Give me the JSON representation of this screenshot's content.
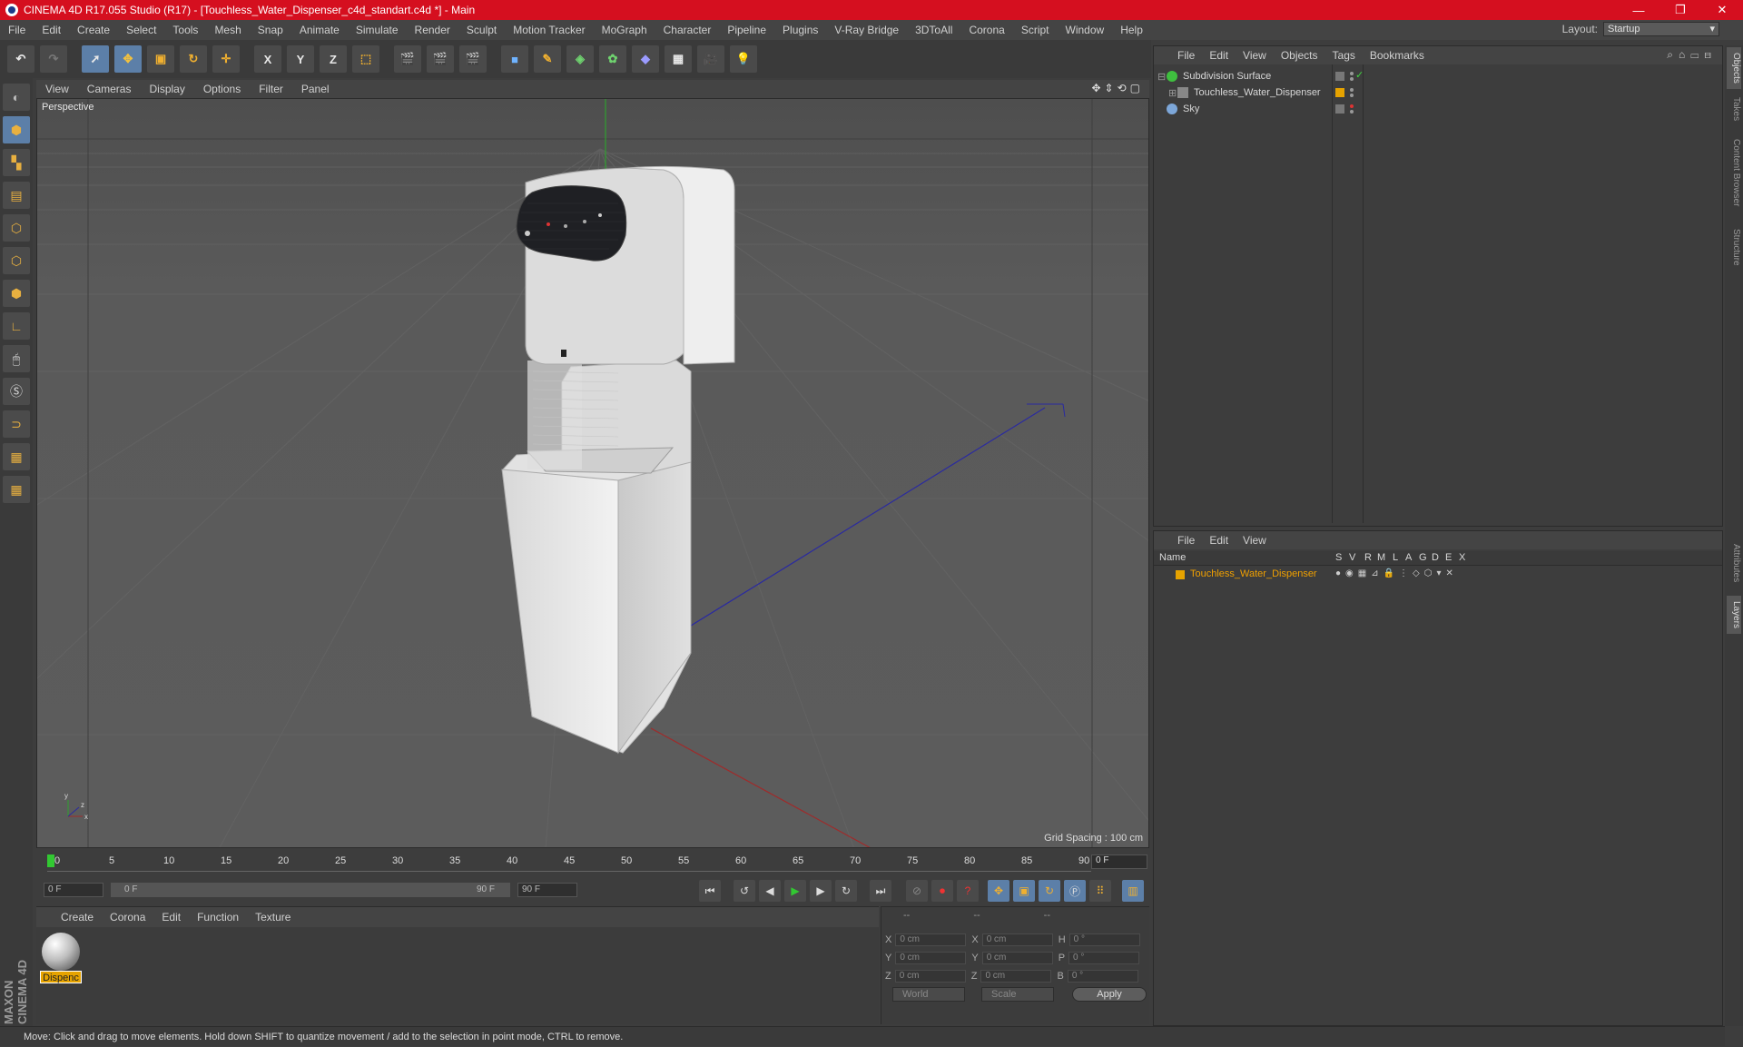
{
  "window": {
    "title": "CINEMA 4D R17.055 Studio (R17) - [Touchless_Water_Dispenser_c4d_standart.c4d *] - Main",
    "buttons": [
      "—",
      "❐",
      "✕"
    ]
  },
  "menu": [
    "File",
    "Edit",
    "Create",
    "Select",
    "Tools",
    "Mesh",
    "Snap",
    "Animate",
    "Simulate",
    "Render",
    "Sculpt",
    "Motion Tracker",
    "MoGraph",
    "Character",
    "Pipeline",
    "Plugins",
    "V-Ray Bridge",
    "3DToAll",
    "Corona",
    "Script",
    "Window",
    "Help"
  ],
  "layout": {
    "label": "Layout:",
    "value": "Startup"
  },
  "toolbar": {
    "axis_x": "X",
    "axis_y": "Y",
    "axis_z": "Z"
  },
  "viewport": {
    "menu": [
      "View",
      "Cameras",
      "Display",
      "Options",
      "Filter",
      "Panel"
    ],
    "label": "Perspective",
    "grid_spacing": "Grid Spacing : 100 cm"
  },
  "timeline": {
    "ticks": [
      "0",
      "5",
      "10",
      "15",
      "20",
      "25",
      "30",
      "35",
      "40",
      "45",
      "50",
      "55",
      "60",
      "65",
      "70",
      "75",
      "80",
      "85",
      "90"
    ],
    "current_frame": "0 F",
    "start_field": "0 F",
    "range_start": "0 F",
    "range_end": "90 F",
    "end_field": "90 F"
  },
  "material_manager": {
    "menu": [
      "Create",
      "Corona",
      "Edit",
      "Function",
      "Texture"
    ],
    "material_name": "Dispenc"
  },
  "coordinates": {
    "headers": [
      "--",
      "--",
      "--"
    ],
    "rows": [
      {
        "a": "X",
        "a_val": "0 cm",
        "b": "X",
        "b_val": "0 cm",
        "c": "H",
        "c_val": "0 °"
      },
      {
        "a": "Y",
        "a_val": "0 cm",
        "b": "Y",
        "b_val": "0 cm",
        "c": "P",
        "c_val": "0 °"
      },
      {
        "a": "Z",
        "a_val": "0 cm",
        "b": "Z",
        "b_val": "0 cm",
        "c": "B",
        "c_val": "0 °"
      }
    ],
    "mode_world": "World",
    "mode_scale": "Scale",
    "apply": "Apply"
  },
  "object_manager": {
    "menu": [
      "File",
      "Edit",
      "View",
      "Objects",
      "Tags",
      "Bookmarks"
    ],
    "objects": [
      "Subdivision Surface",
      "Touchless_Water_Dispenser",
      "Sky"
    ]
  },
  "layer_manager": {
    "menu": [
      "File",
      "Edit",
      "View"
    ],
    "columns": [
      "Name",
      "S",
      "V",
      "R",
      "M",
      "L",
      "A",
      "G",
      "D",
      "E",
      "X"
    ],
    "layer": "Touchless_Water_Dispenser"
  },
  "right_tabs": [
    "Objects",
    "Takes",
    "Content Browser",
    "Structure",
    "Attributes",
    "Layers"
  ],
  "status": "Move: Click and drag to move elements. Hold down SHIFT to quantize movement / add to the selection in point mode, CTRL to remove.",
  "branding": "MAXON CINEMA 4D",
  "colors": {
    "title_bar": "#d50f1f",
    "accent": "#5c7fa8",
    "layer_orange": "#f0a000"
  }
}
